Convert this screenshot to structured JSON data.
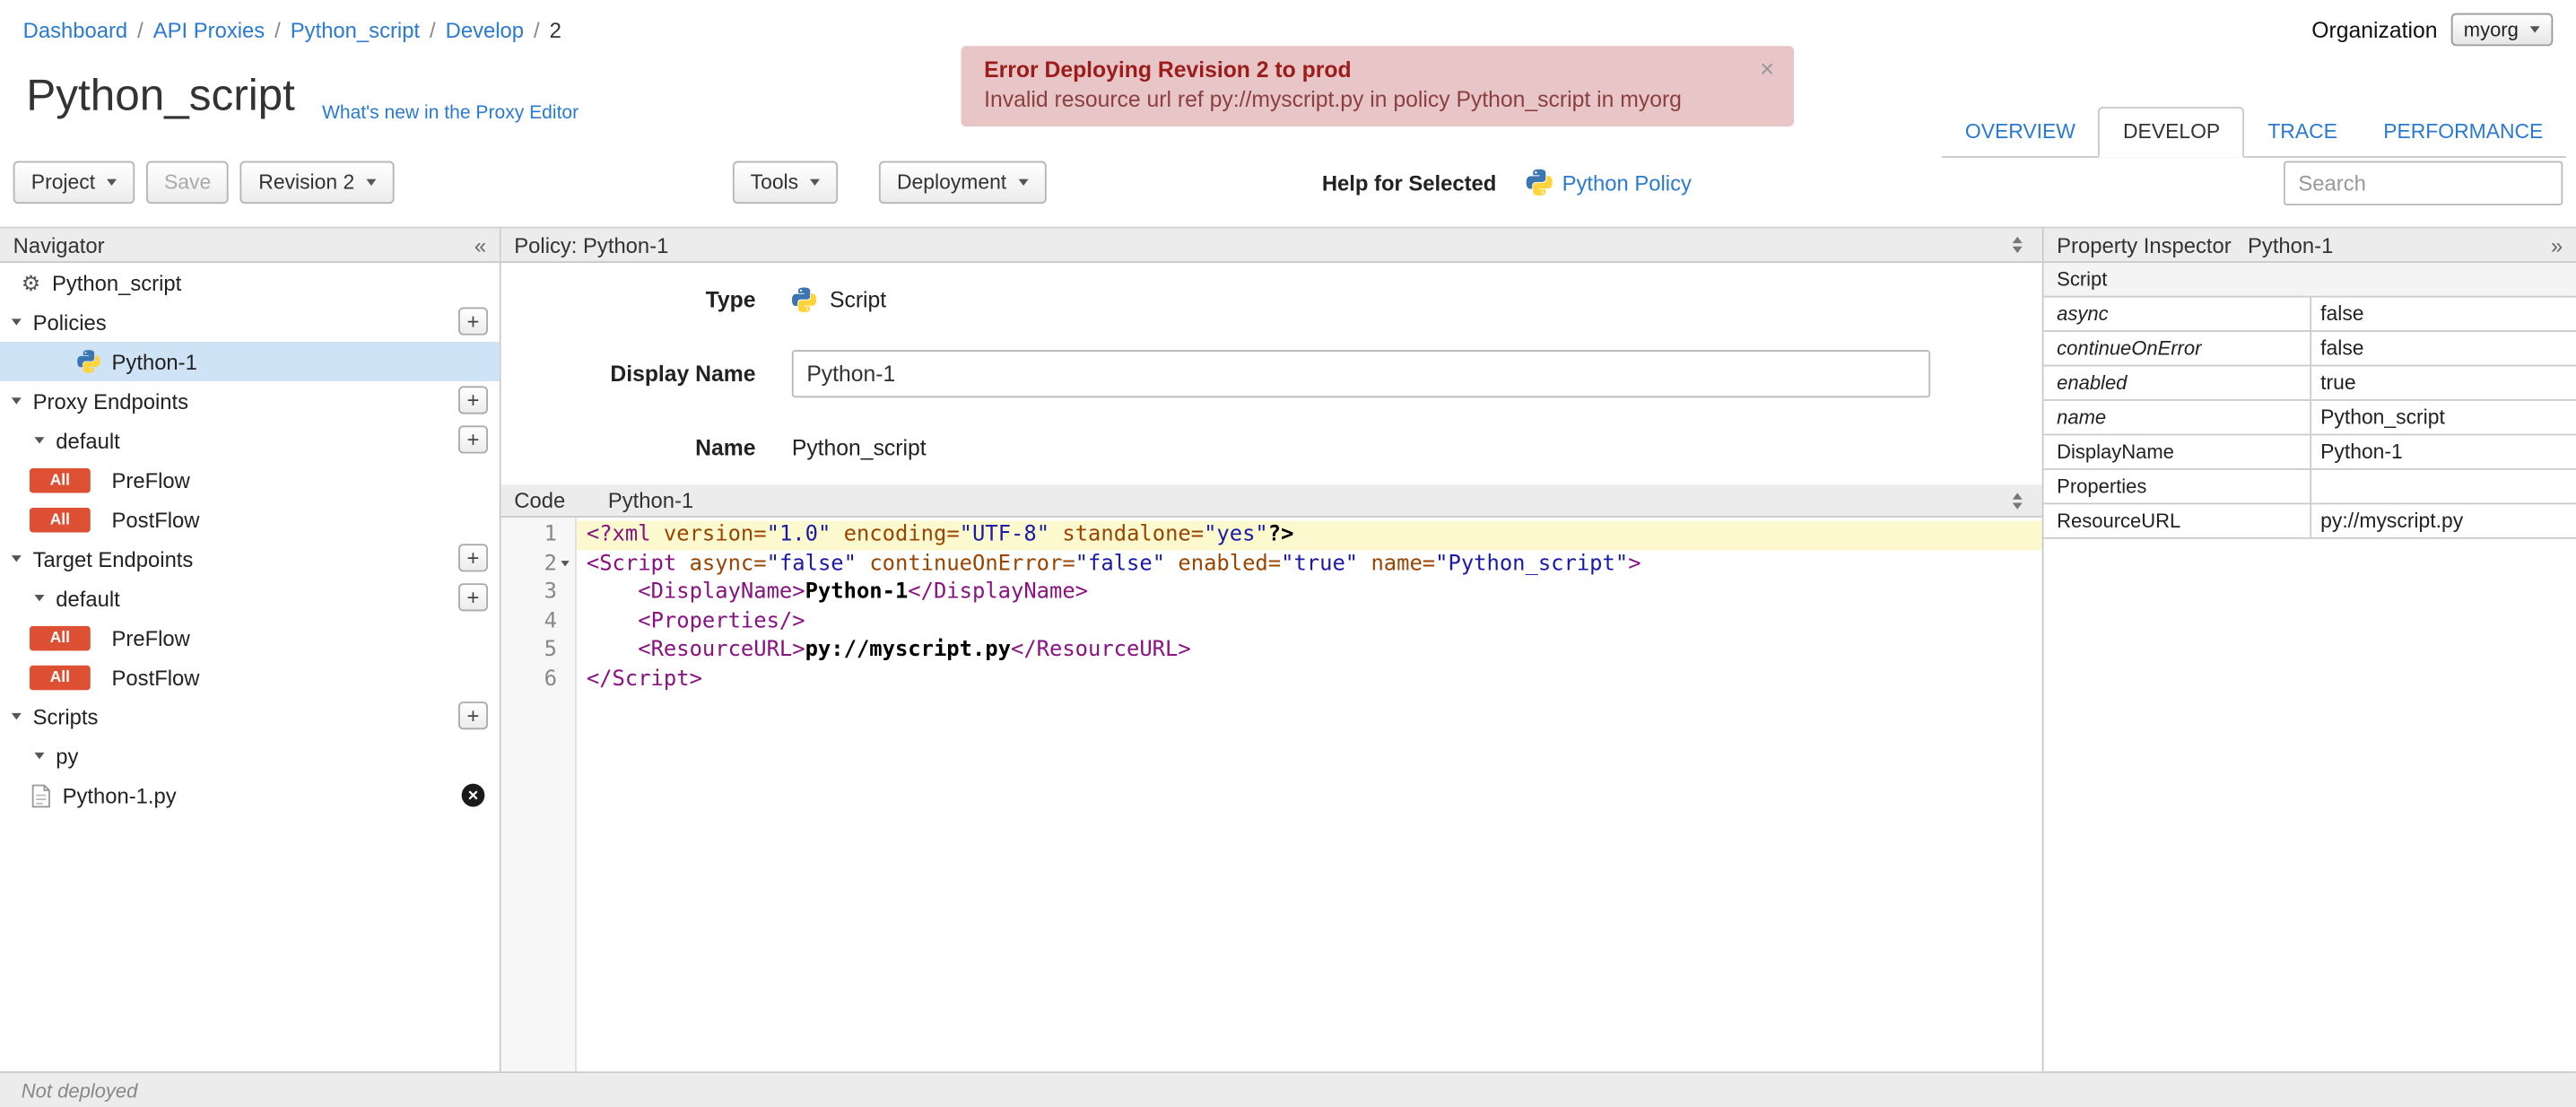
{
  "colors": {
    "link_blue": "#2a7ad2",
    "flow_badge": "#dd5033",
    "error_background": "#e8c5c6",
    "error_title_text": "#9c1c1c",
    "selected_row": "#cfe3f7",
    "active_code_line": "#fcf9cf",
    "python_blue": "#3b76b0",
    "python_yellow": "#ffd43b"
  },
  "breadcrumb": {
    "separator": "/",
    "items": [
      "Dashboard",
      "API Proxies",
      "Python_script",
      "Develop",
      "2"
    ]
  },
  "organization": {
    "label": "Organization",
    "value": "myorg"
  },
  "error_banner": {
    "title": "Error Deploying Revision 2 to prod",
    "message": "Invalid resource url ref py://myscript.py in policy Python_script in myorg",
    "close_label": "×"
  },
  "page": {
    "title": "Python_script",
    "whats_new": "What's new in the Proxy Editor"
  },
  "tabs": [
    "OVERVIEW",
    "DEVELOP",
    "TRACE",
    "PERFORMANCE"
  ],
  "toolbar": {
    "project": "Project",
    "save": "Save",
    "revision": "Revision 2",
    "tools": "Tools",
    "deployment": "Deployment",
    "help_for_selected": "Help for Selected",
    "policy_link": "Python Policy",
    "search_placeholder": "Search"
  },
  "navigator": {
    "title": "Navigator",
    "root_item": "Python_script",
    "policies_label": "Policies",
    "policy_item": "Python-1",
    "proxy_endpoints_label": "Proxy Endpoints",
    "proxy_default": "default",
    "target_endpoints_label": "Target Endpoints",
    "target_default": "default",
    "scripts_label": "Scripts",
    "scripts_group": "py",
    "script_file": "Python-1.py",
    "flow_badge": "All",
    "preflow": "PreFlow",
    "postflow": "PostFlow",
    "add_label": "+"
  },
  "policy_editor": {
    "header": "Policy: Python-1",
    "type_label": "Type",
    "type_value": "Script",
    "display_name_label": "Display Name",
    "display_name_value": "Python-1",
    "name_label": "Name",
    "name_value": "Python_script",
    "code_label": "Code",
    "code_file": "Python-1"
  },
  "code": {
    "lines": [
      {
        "active": true,
        "tokens": [
          {
            "c": "tag",
            "s": "<?xml "
          },
          {
            "c": "attr",
            "s": "version="
          },
          {
            "c": "str",
            "s": "\"1.0\""
          },
          {
            "c": "pln",
            "s": " "
          },
          {
            "c": "attr",
            "s": "encoding="
          },
          {
            "c": "str",
            "s": "\"UTF-8\""
          },
          {
            "c": "pln",
            "s": " "
          },
          {
            "c": "attr",
            "s": "standalone="
          },
          {
            "c": "str",
            "s": "\"yes\""
          },
          {
            "c": "txt",
            "s": "?>"
          }
        ]
      },
      {
        "fold": true,
        "tokens": [
          {
            "c": "tag",
            "s": "<Script "
          },
          {
            "c": "attr",
            "s": "async="
          },
          {
            "c": "str",
            "s": "\"false\""
          },
          {
            "c": "pln",
            "s": " "
          },
          {
            "c": "attr",
            "s": "continueOnError="
          },
          {
            "c": "str",
            "s": "\"false\""
          },
          {
            "c": "pln",
            "s": " "
          },
          {
            "c": "attr",
            "s": "enabled="
          },
          {
            "c": "str",
            "s": "\"true\""
          },
          {
            "c": "pln",
            "s": " "
          },
          {
            "c": "attr",
            "s": "name="
          },
          {
            "c": "str",
            "s": "\"Python_script\""
          },
          {
            "c": "tag",
            "s": ">"
          }
        ]
      },
      {
        "tokens": [
          {
            "c": "pln",
            "s": "    "
          },
          {
            "c": "tag",
            "s": "<DisplayName>"
          },
          {
            "c": "txt",
            "s": "Python-1"
          },
          {
            "c": "tag",
            "s": "</DisplayName>"
          }
        ]
      },
      {
        "tokens": [
          {
            "c": "pln",
            "s": "    "
          },
          {
            "c": "tag",
            "s": "<Properties/>"
          }
        ]
      },
      {
        "tokens": [
          {
            "c": "pln",
            "s": "    "
          },
          {
            "c": "tag",
            "s": "<ResourceURL>"
          },
          {
            "c": "txt",
            "s": "py://myscript.py"
          },
          {
            "c": "tag",
            "s": "</ResourceURL>"
          }
        ]
      },
      {
        "tokens": [
          {
            "c": "tag",
            "s": "</Script>"
          }
        ]
      }
    ]
  },
  "inspector": {
    "title": "Property Inspector",
    "subtitle": "Python-1",
    "section": "Script",
    "rows": [
      {
        "key": "async",
        "value": "false",
        "italic": true
      },
      {
        "key": "continueOnError",
        "value": "false",
        "italic": true
      },
      {
        "key": "enabled",
        "value": "true",
        "italic": true
      },
      {
        "key": "name",
        "value": "Python_script",
        "italic": true
      },
      {
        "key": "DisplayName",
        "value": "Python-1"
      },
      {
        "key": "Properties",
        "value": ""
      },
      {
        "key": "ResourceURL",
        "value": "py://myscript.py"
      }
    ]
  },
  "statusbar": {
    "text": "Not deployed"
  }
}
